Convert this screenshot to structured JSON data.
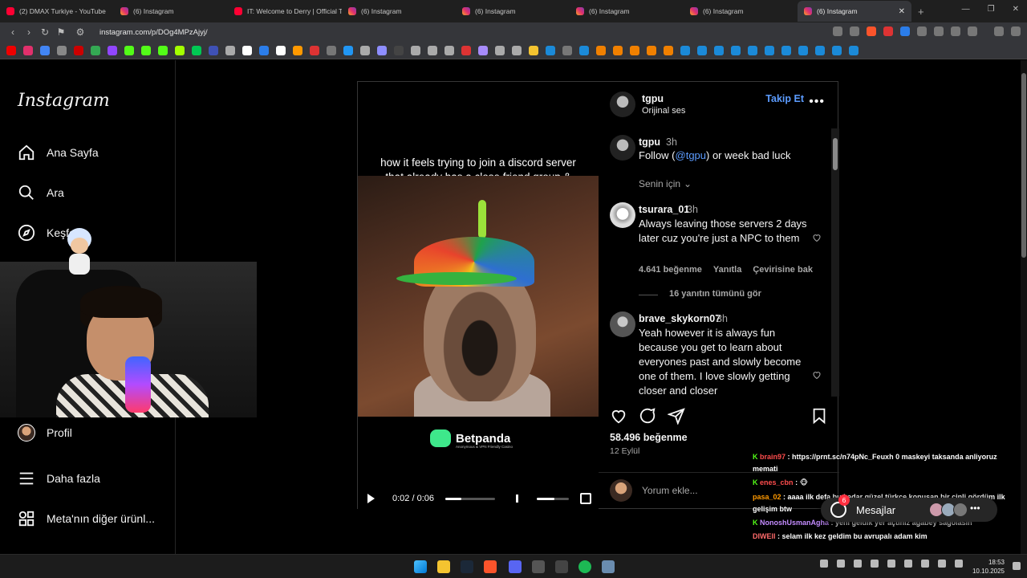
{
  "browser": {
    "tabs": [
      {
        "title": "(2) DMAX Turkiye - YouTube",
        "icon": "youtube-icon"
      },
      {
        "title": "(6) Instagram",
        "icon": "instagram-icon"
      },
      {
        "title": "IT: Welcome to Derry | Official T",
        "icon": "youtube-icon"
      },
      {
        "title": "(6) Instagram",
        "icon": "instagram-icon"
      },
      {
        "title": "(6) Instagram",
        "icon": "instagram-icon"
      },
      {
        "title": "(6) Instagram",
        "icon": "instagram-icon"
      },
      {
        "title": "(6) Instagram",
        "icon": "instagram-icon"
      },
      {
        "title": "(6) Instagram",
        "icon": "instagram-icon",
        "active": true
      }
    ],
    "url": "instagram.com/p/DOg4MPzAjyj/"
  },
  "sidebar": {
    "logo": "Instagram",
    "items": [
      {
        "label": "Ana Sayfa",
        "icon": "home-icon"
      },
      {
        "label": "Ara",
        "icon": "search-icon"
      },
      {
        "label": "Keşfet",
        "icon": "compass-icon"
      },
      {
        "label": "Profil",
        "icon": "avatar"
      },
      {
        "label": "Daha fazla",
        "icon": "menu-icon"
      },
      {
        "label": "Meta'nın diğer ürünl...",
        "icon": "apps-icon"
      }
    ]
  },
  "video": {
    "caption": "how it feels trying to join a discord server that already has a close friend group & inside jokes",
    "sponsor": "Betpanda",
    "sponsor_sub": "Anonymous & VPN Friendly Casino",
    "time": "0:02 / 0:06",
    "progress": 0.33,
    "volume": 0.55
  },
  "post": {
    "author": "tgpu",
    "audio": "Orijinal ses",
    "follow_label": "Takip Et",
    "caption_user": "tgpu",
    "caption_time": "3h",
    "caption_text_pre": "Follow (",
    "caption_mention": "@tgpu",
    "caption_text_post": ") or week bad luck",
    "for_you": "Senin için",
    "comments": [
      {
        "user": "tsurara_01",
        "time": "3h",
        "text": "Always leaving those servers 2 days later cuz you're just a NPC to them",
        "likes": "4.641 beğenme",
        "reply": "Yanıtla",
        "translate": "Çevirisine bak",
        "replies": "16 yanıtın tümünü gör"
      },
      {
        "user": "brave_skykorn07",
        "time": "3h",
        "text": "Yeah however it is always fun because you get to learn about everyones past and slowly become one of them. I love slowly getting closer and closer"
      }
    ],
    "like_count": "58.496 beğenme",
    "date": "12 Eylül",
    "comment_placeholder": "Yorum ekle..."
  },
  "chat": {
    "lines": [
      {
        "nick": "brain97",
        "color": "#ff4d4d",
        "text": ": https://prnt.sc/n74pNc_Feuxh 0 maskeyi taksanda anliyoruz memati"
      },
      {
        "nick": "enes_cbn",
        "color": "#ff4d4d",
        "text": ":"
      },
      {
        "nick": "pasa_02",
        "color": "#ff9900",
        "text": ": aaaa ilk defa bu kadar güzel türkce konuşan bir çinli gördüm ilk gelişim btw"
      },
      {
        "nick": "NonoshUsmanAgha",
        "color": "#c48cff",
        "text": ": yeni geldik yer açtınız agabey sagolasin"
      },
      {
        "nick": "DIWEll",
        "color": "#ff6b6b",
        "text": ": selam ilk kez geldim bu avrupalı adam kim"
      }
    ],
    "kick_mark": "K"
  },
  "messages": {
    "label": "Mesajlar",
    "badge": "6"
  },
  "clock": {
    "time": "18:53",
    "date": "10.10.2025"
  },
  "colors": {
    "accent": "#0095f6",
    "link": "#5c9cff",
    "background": "#000000"
  }
}
